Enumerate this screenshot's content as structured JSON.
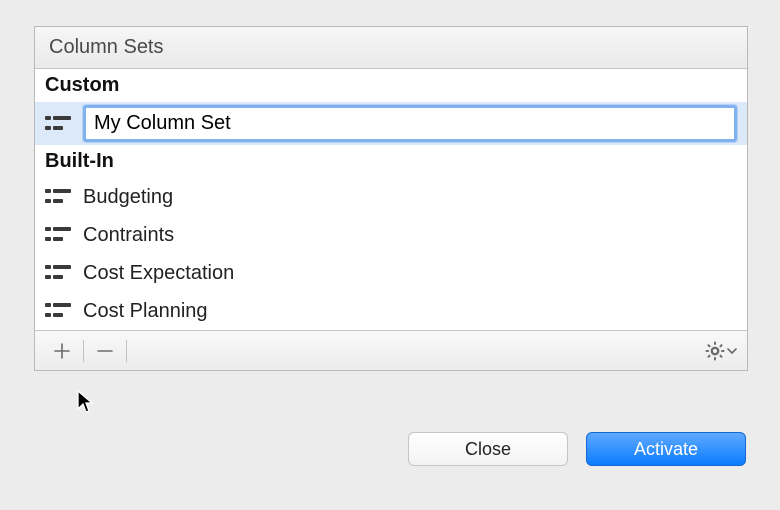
{
  "panel": {
    "title": "Column Sets",
    "sections": {
      "custom": {
        "header": "Custom",
        "editing_value": "My Column Set"
      },
      "builtin": {
        "header": "Built-In",
        "items": [
          {
            "label": "Budgeting"
          },
          {
            "label": "Contraints"
          },
          {
            "label": "Cost Expectation"
          },
          {
            "label": "Cost Planning"
          }
        ]
      }
    }
  },
  "buttons": {
    "close": "Close",
    "activate": "Activate"
  }
}
